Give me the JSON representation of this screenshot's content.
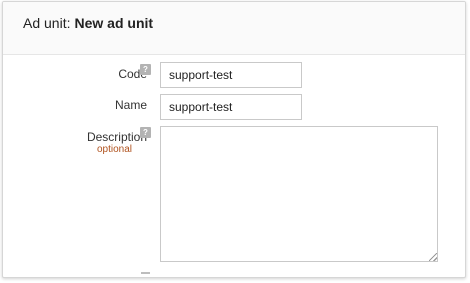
{
  "header": {
    "prefix": "Ad unit:",
    "name": "New ad unit"
  },
  "form": {
    "code": {
      "label": "Code",
      "help_icon": "help-icon",
      "help_glyph": "?",
      "value": "support-test"
    },
    "name": {
      "label": "Name",
      "value": "support-test"
    },
    "description": {
      "label": "Description",
      "help_icon": "help-icon",
      "help_glyph": "?",
      "optional": "optional",
      "value": ""
    }
  },
  "colors": {
    "optional_text": "#b0521e",
    "help_icon_bg": "#b3b3b3",
    "input_border": "#c9c9c9"
  }
}
